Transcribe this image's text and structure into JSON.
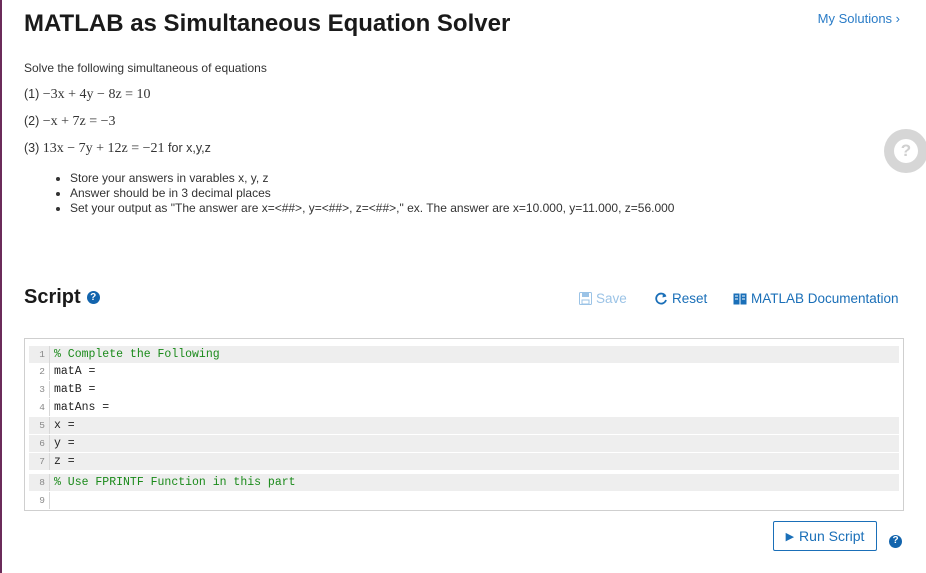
{
  "header": {
    "title": "MATLAB as Simultaneous Equation Solver",
    "my_solutions": "My Solutions ›"
  },
  "problem": {
    "intro": "Solve the following simultaneous of equations",
    "equations": [
      {
        "num": "(1)",
        "math": "−3x + 4y − 8z = 10",
        "suffix": ""
      },
      {
        "num": "(2)",
        "math": "−x + 7z = −3",
        "suffix": ""
      },
      {
        "num": "(3)",
        "math": "13x − 7y + 12z = −21",
        "suffix": "for x,y,z"
      }
    ],
    "bullets": [
      "Store your answers in varables x, y, z",
      "Answer should be in 3 decimal places",
      "Set your output as \"The answer are x=<##>, y=<##>, z=<##>,\" ex. The answer are x=10.000, y=11.000, z=56.000"
    ]
  },
  "script": {
    "heading": "Script",
    "save_label": "Save",
    "reset_label": "Reset",
    "docs_label": "MATLAB Documentation",
    "run_label": "Run Script"
  },
  "editor": {
    "lines": [
      {
        "n": "1",
        "text": "% Complete the Following"
      },
      {
        "n": "2",
        "text": "matA ="
      },
      {
        "n": "3",
        "text": "matB ="
      },
      {
        "n": "4",
        "text": "matAns ="
      },
      {
        "n": "5",
        "text": "x ="
      },
      {
        "n": "6",
        "text": "y ="
      },
      {
        "n": "7",
        "text": "z ="
      },
      {
        "n": "8",
        "text": "% Use FPRINTF Function in this part"
      },
      {
        "n": "9",
        "text": ""
      }
    ]
  },
  "colors": {
    "accent": "#1a6fb8",
    "comment": "#1a8a1a",
    "link": "#2a7cc7"
  }
}
